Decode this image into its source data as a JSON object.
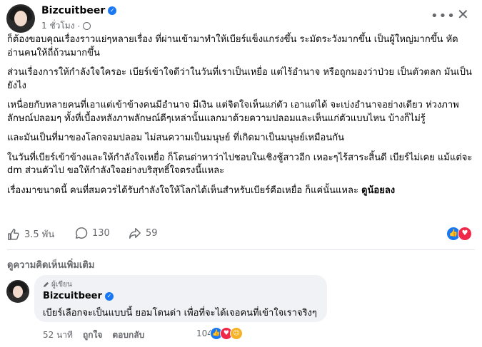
{
  "post": {
    "author": "Bizcuitbeer",
    "time": "1 ชั่วโมง",
    "paragraphs": [
      "ก็ต้องขอบคุณเรื่องราวแย่ๆหลายเรื่อง ที่ผ่านเข้ามาทำให้เบียร์แข็งแกร่งขึ้น ระมัดระวังมากขึ้น เป็นผู้ใหญ่มากขึ้น หัดอ่านคนให้ถี่ถ้วนมากขึ้น",
      "ส่วนเรื่องการให้กำลังใจใครอะ เบียร์เข้าใจดีว่าในวันที่เราเป็นเหยื่อ แต่ไร้อำนาจ หรือถูกมองว่าป่วย เป็นตัวตลก มันเป็นยังไง",
      "เหนื่อยกับหลายคนที่เอาแต่เข้าข้างคนมีอำนาจ มีเงิน แต่จิตใจเห็นแก่ตัว เอาแต่ได้ จะเบ่งอำนาจอย่างเดียว ห่วงภาพลักษณ์ปลอมๆ ทั้งที่เบื้องหลังภาพลักษณ์ดีๆเหล่านั้นแลกมาด้วยความปลอมและเห็นแก่ตัวแบบไหน บ้างก็ไม่รู้",
      "และมันเป็นที่มาของโลกจอมปลอม ไม่สนความเป็นมนุษย์ ที่เกิดมาเป็นมนุษย์เหมือนกัน",
      "ในวันที่เบียร์เข้าข้างและให้กำลังใจเหยื่อ ก็โดนด่าหาว่าไปชอบในเชิงชู้สาวอีก เหอะๆไร้สาระสิ้นดี เบียร์ไม่เคย แม้แต่จะ dm ส่วนตัวไป ขอให้กำลังใจอย่างบริสุทธิ์ใจตรงนี้แหละ"
    ],
    "last_paragraph": "เรื่องมาขนาดนี้ คนที่สมควรได้รับกำลังใจให้โลกได้เห็นสำหรับเบียร์คือเหยื่อ ก็แค่นั้นแหละ ",
    "last_bold": "ดูน้อยลง",
    "likes": "3.5 พัน",
    "comments_count": "130",
    "shares": "59"
  },
  "more_comments": "ดูความคิดเห็นเพิ่มเติม",
  "comment": {
    "badge": "ผู้เขียน",
    "author": "Bizcuitbeer",
    "text": "เบียร์เลือกจะเป็นแบบนี้ ยอมโดนด่า เพื่อที่จะได้เจอคนที่เข้าใจเราจริงๆ",
    "time": "52 นาที",
    "like_label": "ถูกใจ",
    "reply_label": "ตอบกลับ",
    "reaction_count": "104"
  },
  "colors": {
    "accent": "#1877f2",
    "love": "#f02849",
    "care": "#f7b125",
    "muted": "#65676b"
  }
}
